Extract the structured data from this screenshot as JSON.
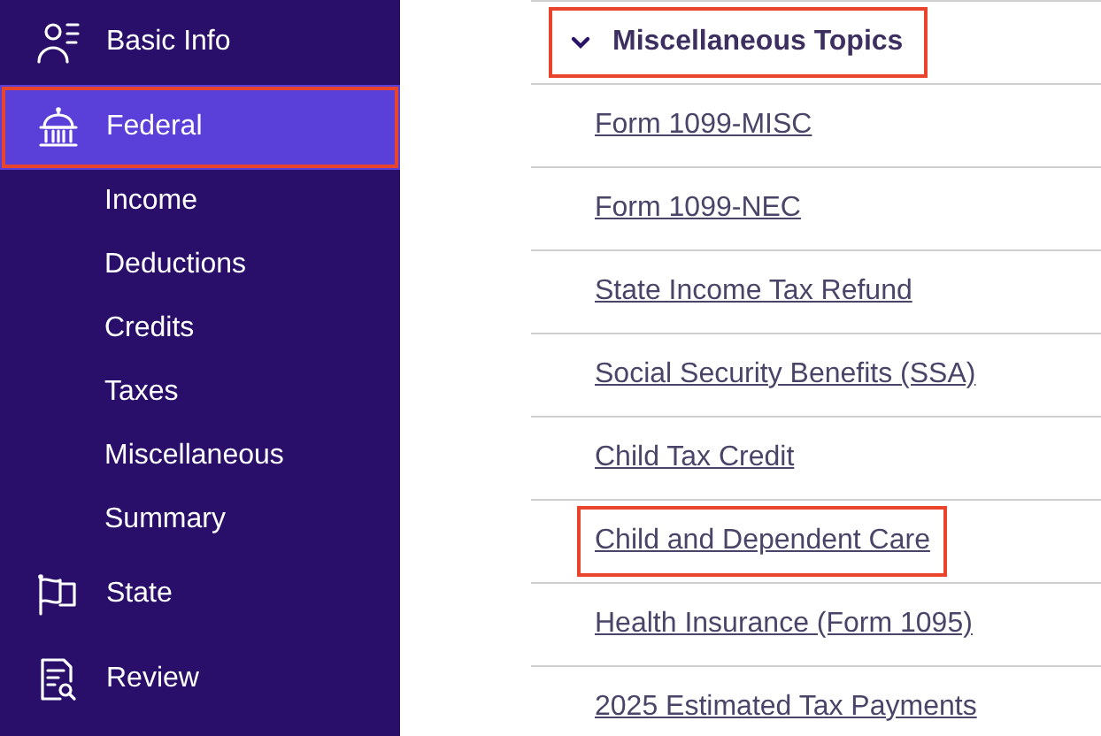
{
  "sidebar": {
    "items": [
      {
        "kind": "main",
        "label": "Basic Info",
        "selected": false,
        "highlighted": false
      },
      {
        "kind": "main",
        "label": "Federal",
        "selected": true,
        "highlighted": true
      },
      {
        "kind": "sub",
        "label": "Income",
        "selected": false,
        "highlighted": false
      },
      {
        "kind": "sub",
        "label": "Deductions",
        "selected": false,
        "highlighted": false
      },
      {
        "kind": "sub",
        "label": "Credits",
        "selected": false,
        "highlighted": false
      },
      {
        "kind": "sub",
        "label": "Taxes",
        "selected": false,
        "highlighted": false
      },
      {
        "kind": "sub",
        "label": "Miscellaneous",
        "selected": false,
        "highlighted": false
      },
      {
        "kind": "sub",
        "label": "Summary",
        "selected": false,
        "highlighted": false
      },
      {
        "kind": "main",
        "label": "State",
        "selected": false,
        "highlighted": false
      },
      {
        "kind": "main",
        "label": "Review",
        "selected": false,
        "highlighted": false
      }
    ]
  },
  "section": {
    "title": "Miscellaneous Topics",
    "expanded": true,
    "highlighted": true,
    "links": [
      {
        "label": "Form 1099-MISC",
        "highlighted": false
      },
      {
        "label": "Form 1099-NEC",
        "highlighted": false
      },
      {
        "label": "State Income Tax Refund",
        "highlighted": false
      },
      {
        "label": "Social Security Benefits (SSA)",
        "highlighted": false
      },
      {
        "label": "Child Tax Credit",
        "highlighted": false
      },
      {
        "label": "Child and Dependent Care",
        "highlighted": true
      },
      {
        "label": "Health Insurance (Form 1095)",
        "highlighted": false
      },
      {
        "label": "2025 Estimated Tax Payments",
        "highlighted": false
      }
    ]
  }
}
